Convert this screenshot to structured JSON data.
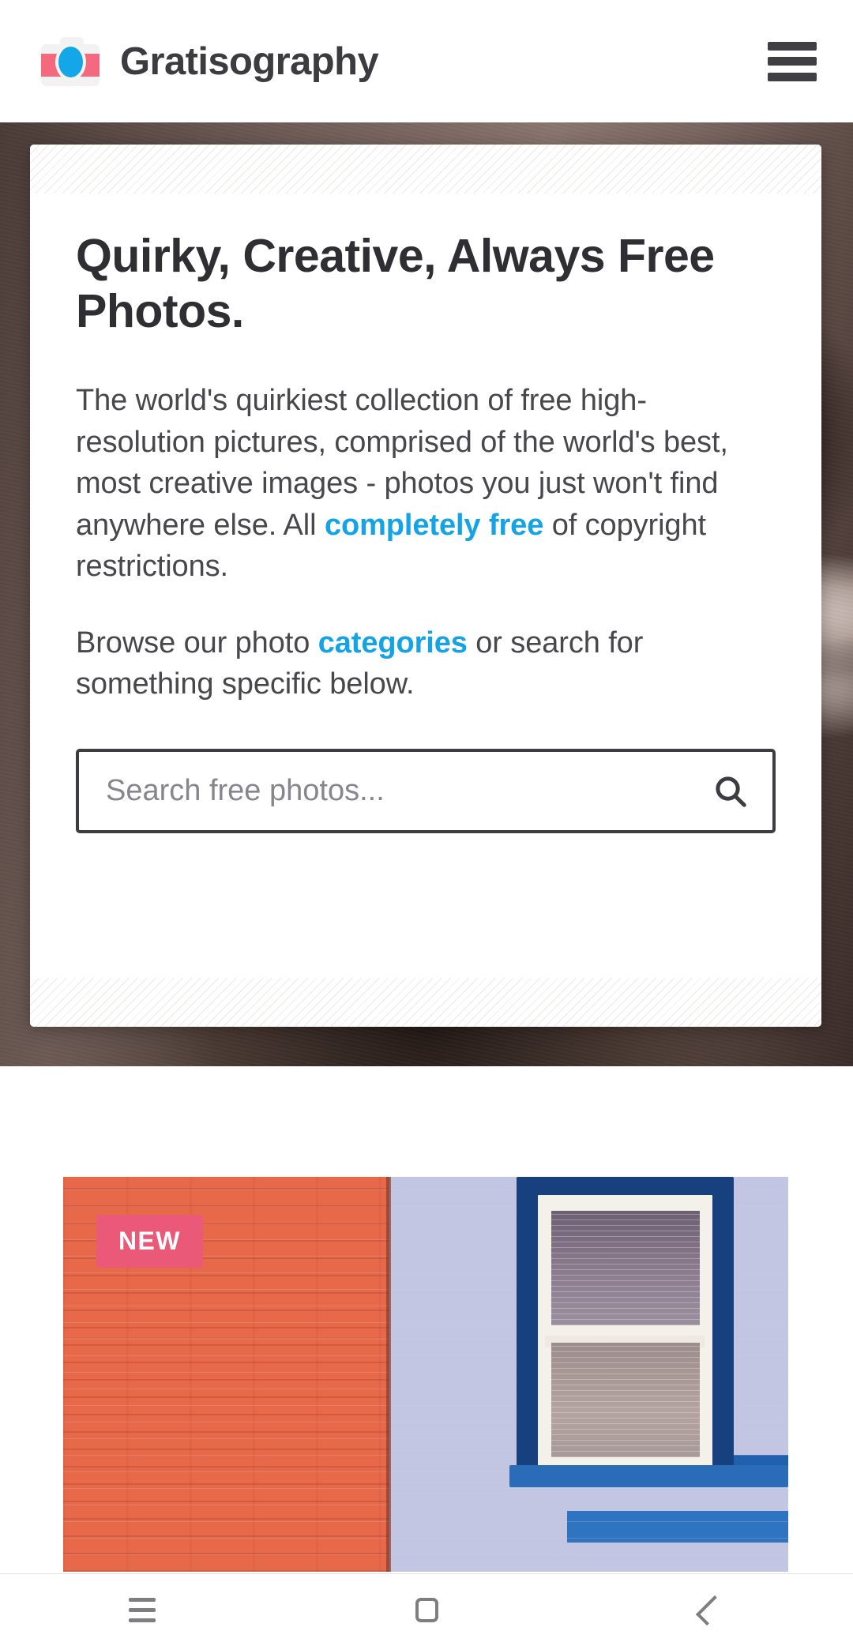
{
  "header": {
    "brand_name": "Gratisography",
    "logo_icon": "camera-icon",
    "menu_icon": "hamburger-menu-icon"
  },
  "hero": {
    "headline": "Quirky, Creative, Always Free Photos.",
    "paragraph1_part1": "The world's quirkiest collection of free high-resolution pictures, comprised of the world's best, most creative images - photos you just won't find anywhere else. All ",
    "paragraph1_link": "completely free",
    "paragraph1_part2": " of copyright restrictions.",
    "paragraph2_part1": "Browse our photo ",
    "paragraph2_link": "categories",
    "paragraph2_part2": " or search for something specific below.",
    "background_description": "camera lens close-up photo"
  },
  "search": {
    "placeholder": "Search free photos...",
    "value": "",
    "icon": "search-icon"
  },
  "gallery": {
    "photos": [
      {
        "badge": "NEW",
        "description": "orange brick wall beside lavender brick wall with blue framed window"
      }
    ]
  },
  "system_nav": {
    "recents_label": "Recents",
    "home_label": "Home",
    "back_label": "Back"
  },
  "colors": {
    "link_blue": "#14a3e5",
    "badge_pink": "#ea5a78",
    "logo_pink": "#f4697e",
    "logo_blue": "#13a6e8",
    "text_dark": "#2e2e33",
    "body_text": "#47474c"
  }
}
